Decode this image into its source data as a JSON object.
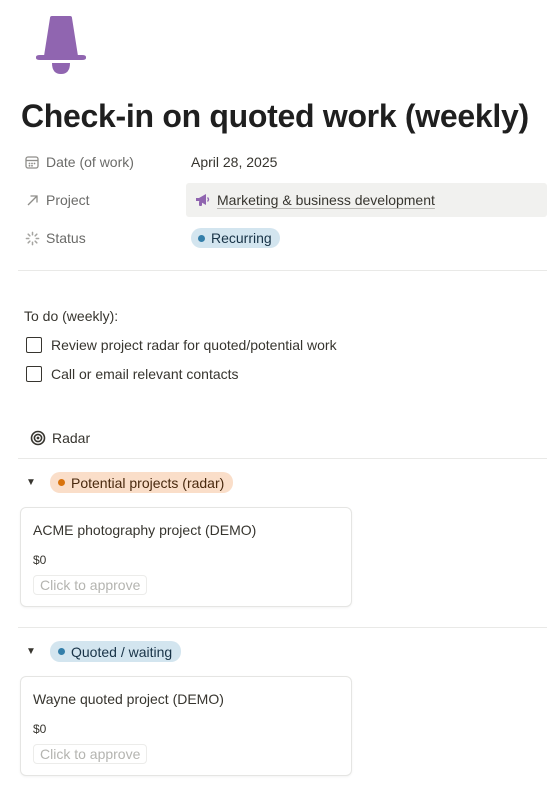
{
  "page": {
    "icon": "bell-icon",
    "title": "Check-in on quoted work (weekly)"
  },
  "properties": {
    "date": {
      "label": "Date (of work)",
      "icon": "calendar-icon",
      "value": "April 28, 2025"
    },
    "project": {
      "label": "Project",
      "icon": "arrow-up-right-icon",
      "value": "Marketing & business development",
      "value_icon": "megaphone-icon"
    },
    "status": {
      "label": "Status",
      "icon": "status-loader-icon",
      "value": "Recurring",
      "color": "#337ea9"
    }
  },
  "todo": {
    "heading": "To do (weekly):",
    "items": [
      {
        "label": "Review project radar for quoted/potential work",
        "checked": false
      },
      {
        "label": "Call or email relevant contacts",
        "checked": false
      }
    ]
  },
  "view": {
    "label": "Radar",
    "icon": "target-icon"
  },
  "groups": [
    {
      "name": "Potential projects (radar)",
      "dot_color": "#d9730d",
      "bg_color": "#fadec9",
      "cards": [
        {
          "title": "ACME photography project (DEMO)",
          "amount": "$0",
          "action": "Click to approve"
        }
      ]
    },
    {
      "name": "Quoted / waiting",
      "dot_color": "#337ea9",
      "bg_color": "#d3e5ef",
      "cards": [
        {
          "title": "Wayne quoted project (DEMO)",
          "amount": "$0",
          "action": "Click to approve"
        }
      ]
    }
  ]
}
